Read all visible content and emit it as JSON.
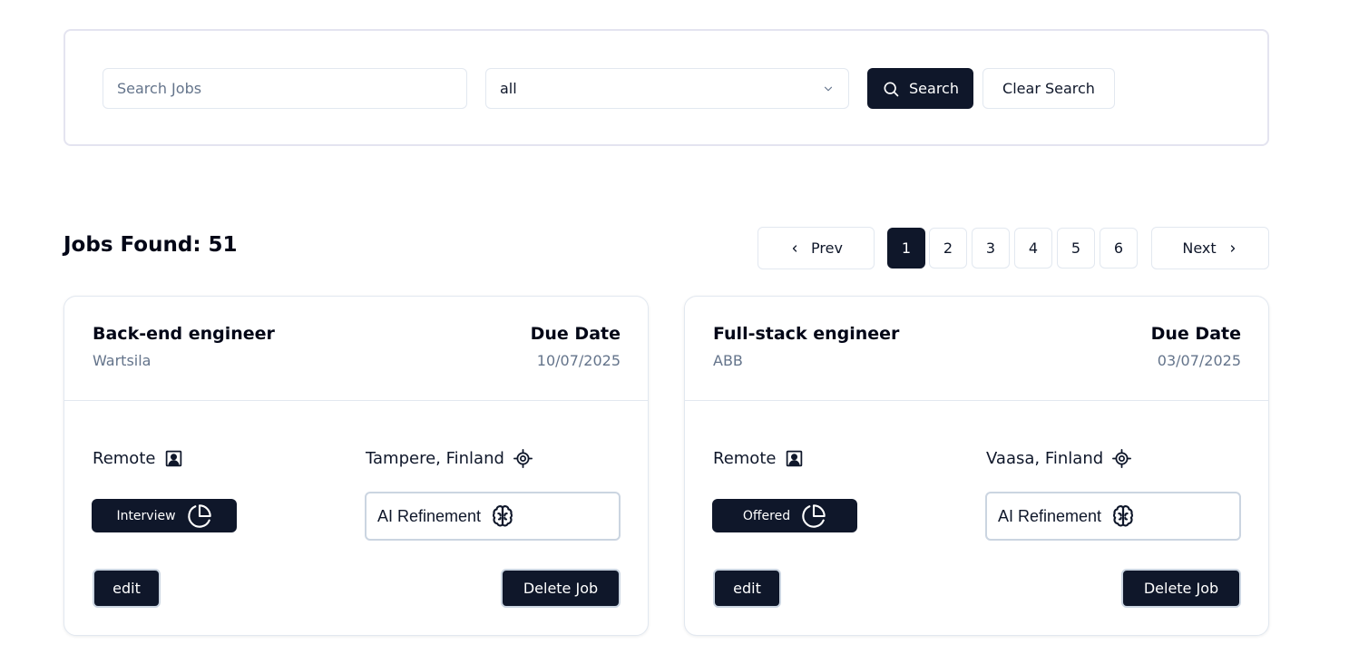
{
  "search": {
    "placeholder": "Search Jobs",
    "value": "",
    "status_selected": "all",
    "search_label": "Search",
    "clear_label": "Clear Search"
  },
  "results": {
    "jobs_found": "Jobs Found: 51"
  },
  "pagination": {
    "prev_label": "Prev",
    "next_label": "Next",
    "pages": [
      "1",
      "2",
      "3",
      "4",
      "5",
      "6"
    ],
    "current": "1"
  },
  "jobs": [
    {
      "title": "Back-end engineer",
      "company": "Wartsila",
      "due_label": "Due Date",
      "due_date": "10/07/2025",
      "mode": "Remote",
      "location": "Tampere, Finland",
      "status": "Interview",
      "ai_label": "AI Refinement",
      "edit_label": "edit",
      "delete_label": "Delete Job"
    },
    {
      "title": "Full-stack engineer",
      "company": "ABB",
      "due_label": "Due Date",
      "due_date": "03/07/2025",
      "mode": "Remote",
      "location": "Vaasa, Finland",
      "status": "Offered",
      "ai_label": "AI Refinement",
      "edit_label": "edit",
      "delete_label": "Delete Job"
    }
  ],
  "icons": {
    "search": "search-icon",
    "chevron_down": "chevron-down-icon",
    "chevron_left": "chevron-left-icon",
    "chevron_right": "chevron-right-icon",
    "remote": "user-square-icon",
    "location": "locate-icon",
    "status": "pie-chart-icon",
    "ai": "brain-icon"
  },
  "colors": {
    "primary": "#0f172a",
    "muted_text": "#64748b",
    "border": "#e2e8f0"
  }
}
